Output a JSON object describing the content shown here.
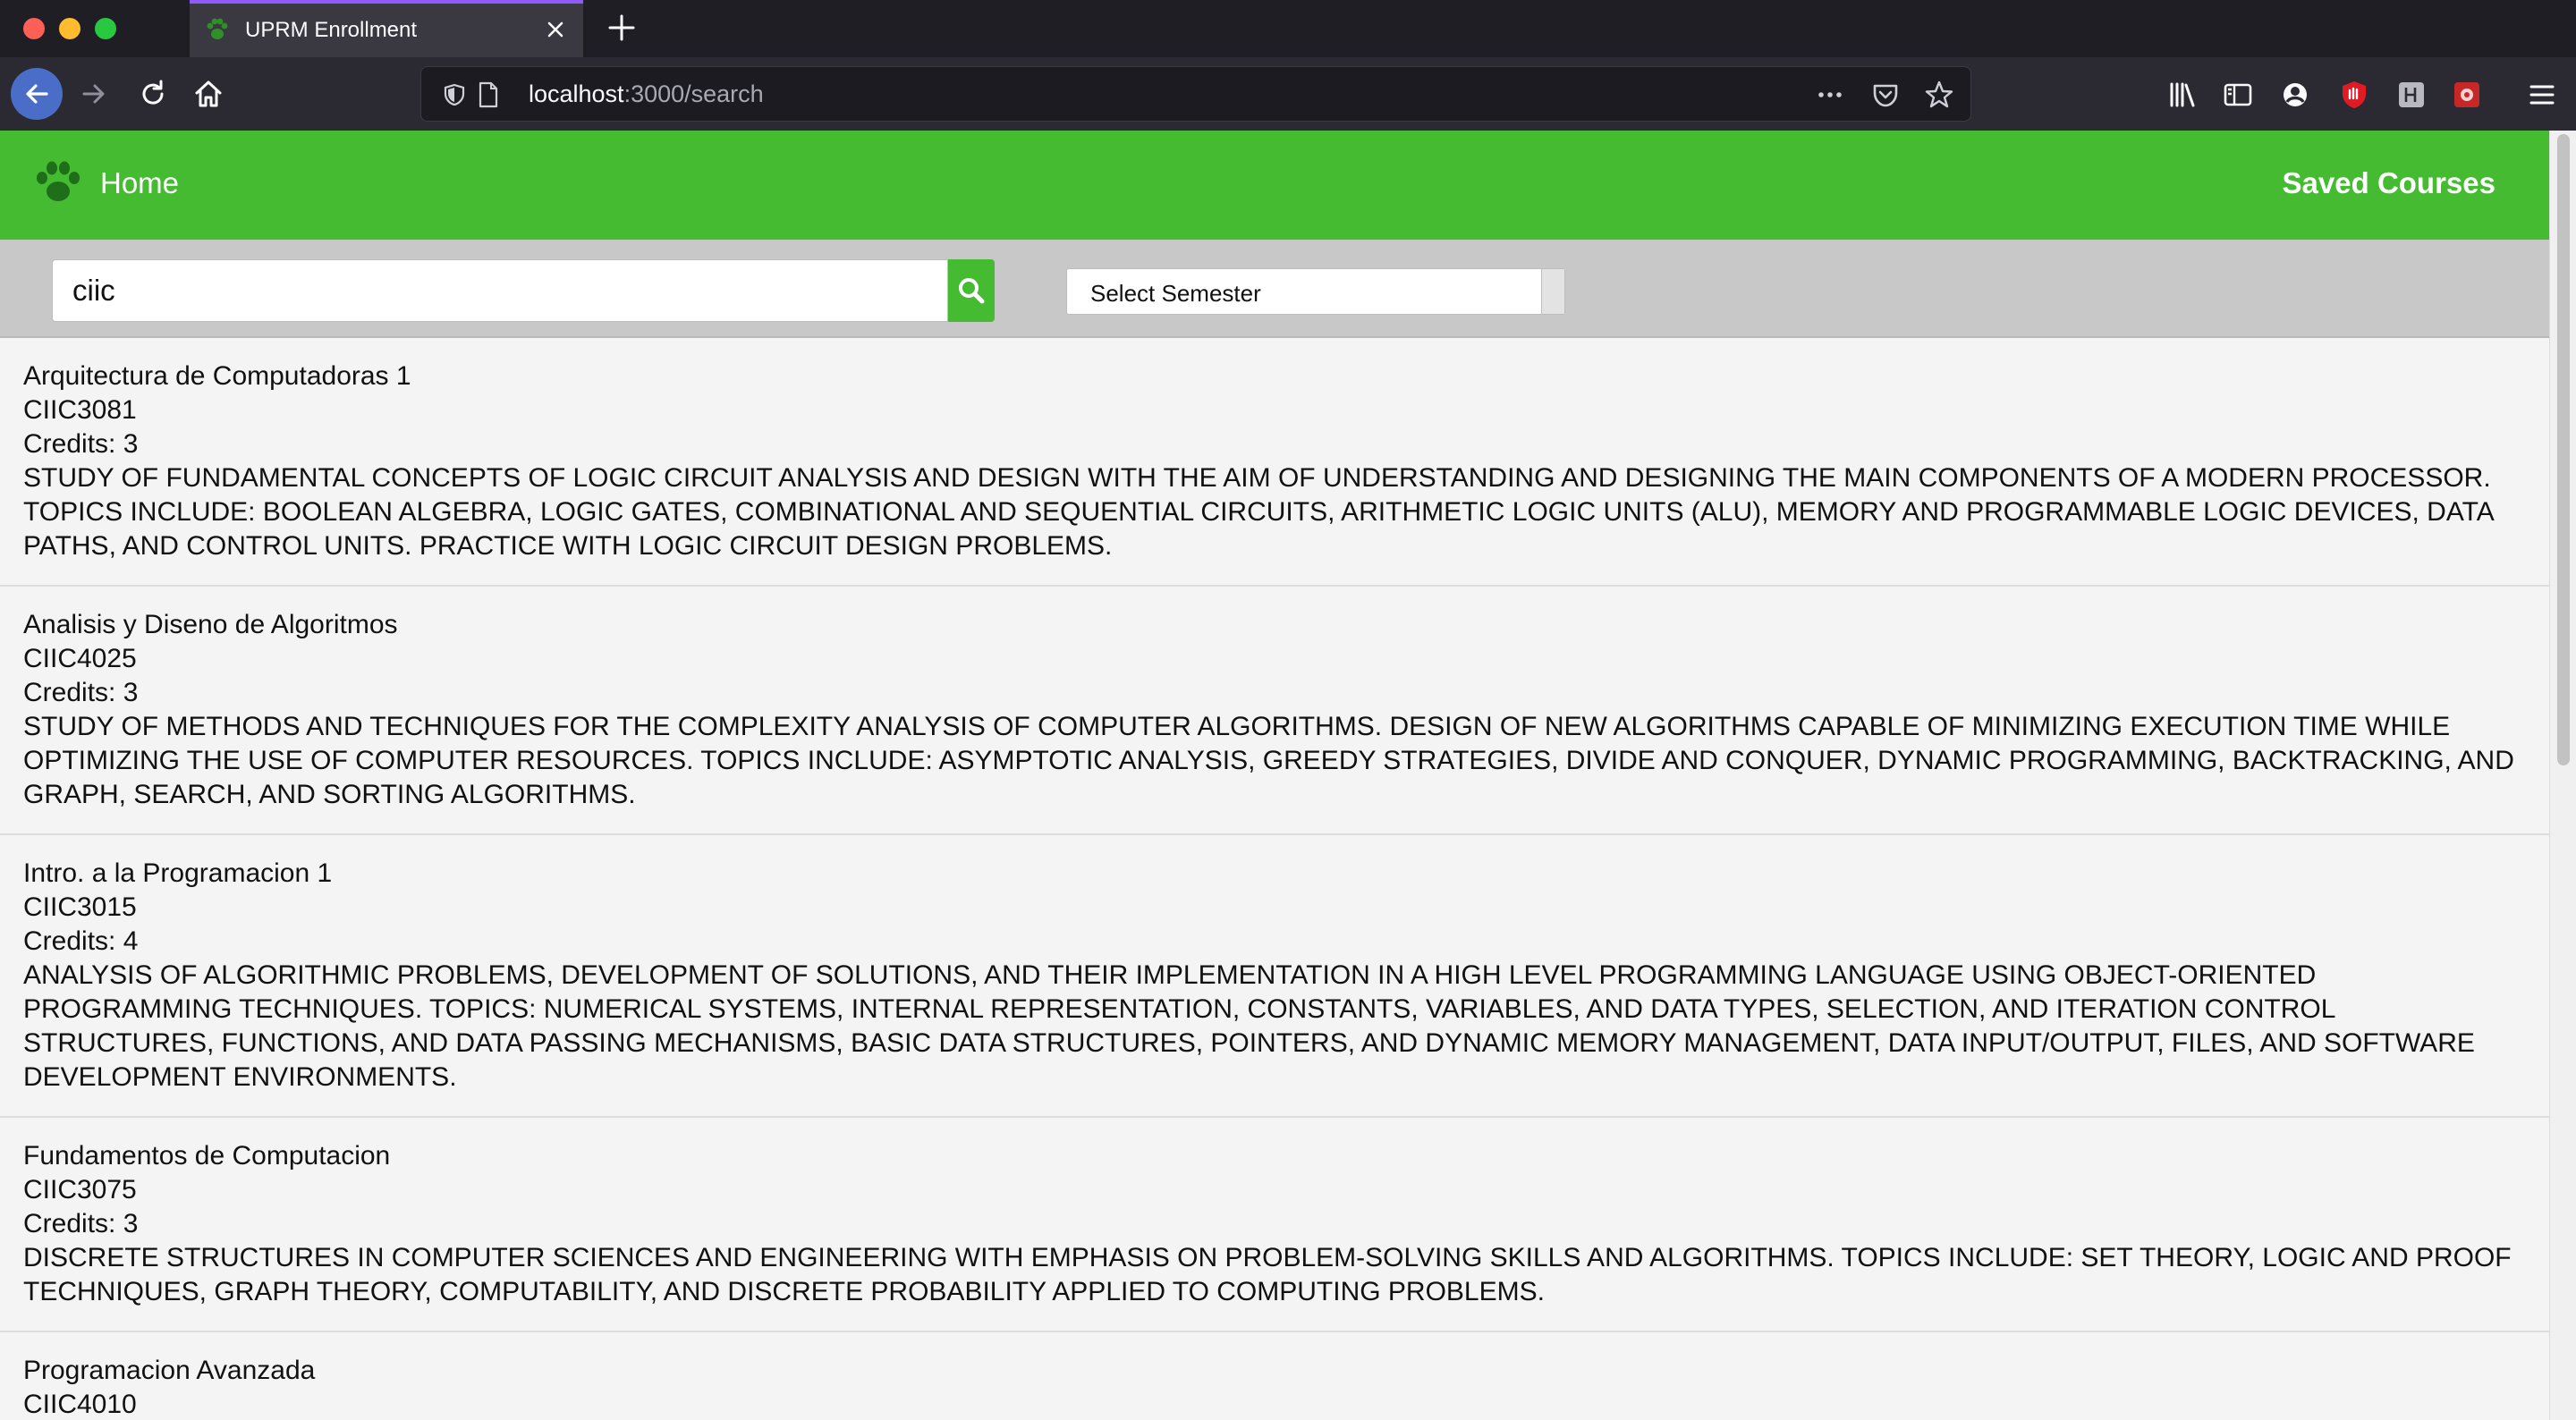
{
  "browser": {
    "tab_title": "UPRM Enrollment",
    "url_host": "localhost",
    "url_path": ":3000/search"
  },
  "app": {
    "brand_label": "Home",
    "saved_link": "Saved Courses",
    "search": {
      "value": "ciic",
      "placeholder": ""
    },
    "semester": {
      "selected": "Select Semester"
    },
    "colors": {
      "accent": "#45bb32"
    }
  },
  "courses": [
    {
      "title": "Arquitectura de Computadoras 1",
      "code": "CIIC3081",
      "credits": "Credits: 3",
      "description": "STUDY OF FUNDAMENTAL CONCEPTS OF LOGIC CIRCUIT ANALYSIS AND DESIGN WITH THE AIM OF UNDERSTANDING AND DESIGNING THE MAIN COMPONENTS OF A MODERN PROCESSOR. TOPICS INCLUDE: BOOLEAN ALGEBRA, LOGIC GATES, COMBINATIONAL AND SEQUENTIAL CIRCUITS, ARITHMETIC LOGIC UNITS (ALU), MEMORY AND PROGRAMMABLE LOGIC DEVICES, DATA PATHS, AND CONTROL UNITS. PRACTICE WITH LOGIC CIRCUIT DESIGN PROBLEMS."
    },
    {
      "title": "Analisis y Diseno de Algoritmos",
      "code": "CIIC4025",
      "credits": "Credits: 3",
      "description": "STUDY OF METHODS AND TECHNIQUES FOR THE COMPLEXITY ANALYSIS OF COMPUTER ALGORITHMS. DESIGN OF NEW ALGORITHMS CAPABLE OF MINIMIZING EXECUTION TIME WHILE OPTIMIZING THE USE OF COMPUTER RESOURCES. TOPICS INCLUDE: ASYMPTOTIC ANALYSIS, GREEDY STRATEGIES, DIVIDE AND CONQUER, DYNAMIC PROGRAMMING, BACKTRACKING, AND GRAPH, SEARCH, AND SORTING ALGORITHMS."
    },
    {
      "title": "Intro. a la Programacion 1",
      "code": "CIIC3015",
      "credits": "Credits: 4",
      "description": "ANALYSIS OF ALGORITHMIC PROBLEMS, DEVELOPMENT OF SOLUTIONS, AND THEIR IMPLEMENTATION IN A HIGH LEVEL PROGRAMMING LANGUAGE USING OBJECT-ORIENTED PROGRAMMING TECHNIQUES. TOPICS: NUMERICAL SYSTEMS, INTERNAL REPRESENTATION, CONSTANTS, VARIABLES, AND DATA TYPES, SELECTION, AND ITERATION CONTROL STRUCTURES, FUNCTIONS, AND DATA PASSING MECHANISMS, BASIC DATA STRUCTURES, POINTERS, AND DYNAMIC MEMORY MANAGEMENT, DATA INPUT/OUTPUT, FILES, AND SOFTWARE DEVELOPMENT ENVIRONMENTS."
    },
    {
      "title": "Fundamentos de Computacion",
      "code": "CIIC3075",
      "credits": "Credits: 3",
      "description": "DISCRETE STRUCTURES IN COMPUTER SCIENCES AND ENGINEERING WITH EMPHASIS ON PROBLEM-SOLVING SKILLS AND ALGORITHMS. TOPICS INCLUDE: SET THEORY, LOGIC AND PROOF TECHNIQUES, GRAPH THEORY, COMPUTABILITY, AND DISCRETE PROBABILITY APPLIED TO COMPUTING PROBLEMS."
    },
    {
      "title": "Programacion Avanzada",
      "code": "CIIC4010",
      "credits": "",
      "description": ""
    }
  ]
}
